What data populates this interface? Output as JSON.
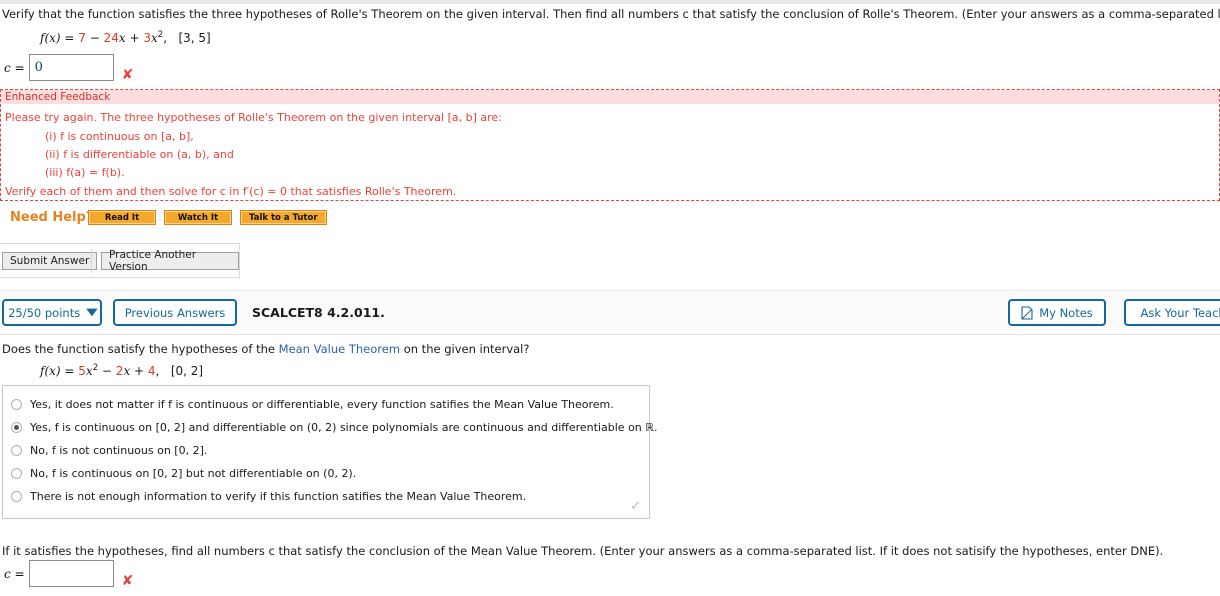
{
  "question1": {
    "prompt": "Verify that the function satisfies the three hypotheses of Rolle's Theorem on the given interval. Then find all numbers c that satisfy the conclusion of Rolle's Theorem. (Enter your answers as a comma-separated list.)",
    "formula": "f(x) = 7 − 24x + 3x²,   [3, 5]",
    "formula_parts": {
      "fx": "f(x)",
      "eq": " = ",
      "t1": "7",
      "op1": " − ",
      "t2": "24",
      "xv": "x",
      "op2": " + ",
      "t3": "3",
      "xv2": "x",
      "exp": "2",
      "comma": ",",
      "interval": "[3, 5]"
    },
    "answer_label": "c =",
    "answer_value": "0",
    "answer_status_icon": "x-mark-incorrect",
    "feedback": {
      "header": "Enhanced Feedback",
      "line1": "Please try again. The three hypotheses of Rolle's Theorem on the given interval  [a, b]  are:",
      "line2": "(i)  f  is continuous on  [a, b],",
      "line3": "(ii)  f  is differentiable on  (a, b),  and",
      "line4": "(iii)  f(a) = f(b).",
      "line5": "Verify each of them and then solve for c in  f′(c) = 0  that satisfies Rolle's Theorem."
    },
    "need_help_label": "Need Help?",
    "help_buttons": [
      "Read It",
      "Watch It",
      "Talk to a Tutor"
    ],
    "submit_label": "Submit Answer",
    "practice_label": "Practice Another Version"
  },
  "question2": {
    "points": "25/50 points",
    "points_chevron_icon": "chevron-down-icon",
    "previous_answers": "Previous Answers",
    "problem_id": "SCALCET8 4.2.011.",
    "my_notes": "My Notes",
    "my_notes_icon": "note-page-icon",
    "ask_teacher": "Ask Your Teacher",
    "prompt_before": "Does the function satisfy the hypotheses of the ",
    "prompt_link": "Mean Value Theorem",
    "prompt_after": " on the given interval?",
    "formula_parts": {
      "fx": "f(x)",
      "eq": " = ",
      "t1": "5",
      "xv": "x",
      "exp": "2",
      "op1": " − ",
      "t2": "2",
      "xv2": "x",
      "op2": " + ",
      "t3": "4",
      "comma": ",",
      "interval": "[0, 2]"
    },
    "options": [
      {
        "text": "Yes, it does not matter if f is continuous or differentiable, every function satifies the Mean Value Theorem.",
        "selected": false
      },
      {
        "text": "Yes, f is continuous on [0, 2] and differentiable on (0, 2) since polynomials are continuous and differentiable on ℝ.",
        "selected": true
      },
      {
        "text": "No, f is not continuous on [0, 2].",
        "selected": false
      },
      {
        "text": "No, f is continuous on [0, 2] but not differentiable on (0, 2).",
        "selected": false
      },
      {
        "text": "There is not enough information to verify if this function satifies the Mean Value Theorem.",
        "selected": false
      }
    ],
    "options_status_icon": "checkmark-gray",
    "tail_prompt": "If it satisfies the hypotheses, find all numbers c that satisfy the conclusion of the Mean Value Theorem. (Enter your answers as a comma-separated list. If it does not satisify the hypotheses, enter DNE).",
    "answer_label": "c =",
    "answer_value": "",
    "answer_placeholder": "",
    "answer_status_icon": "x-mark-incorrect"
  },
  "colors": {
    "accent_blue": "#1268a0",
    "link_blue": "#2b63ad",
    "error_red": "#e8423a",
    "help_orange": "#f5a92b",
    "math_red": "#d93b1e"
  }
}
